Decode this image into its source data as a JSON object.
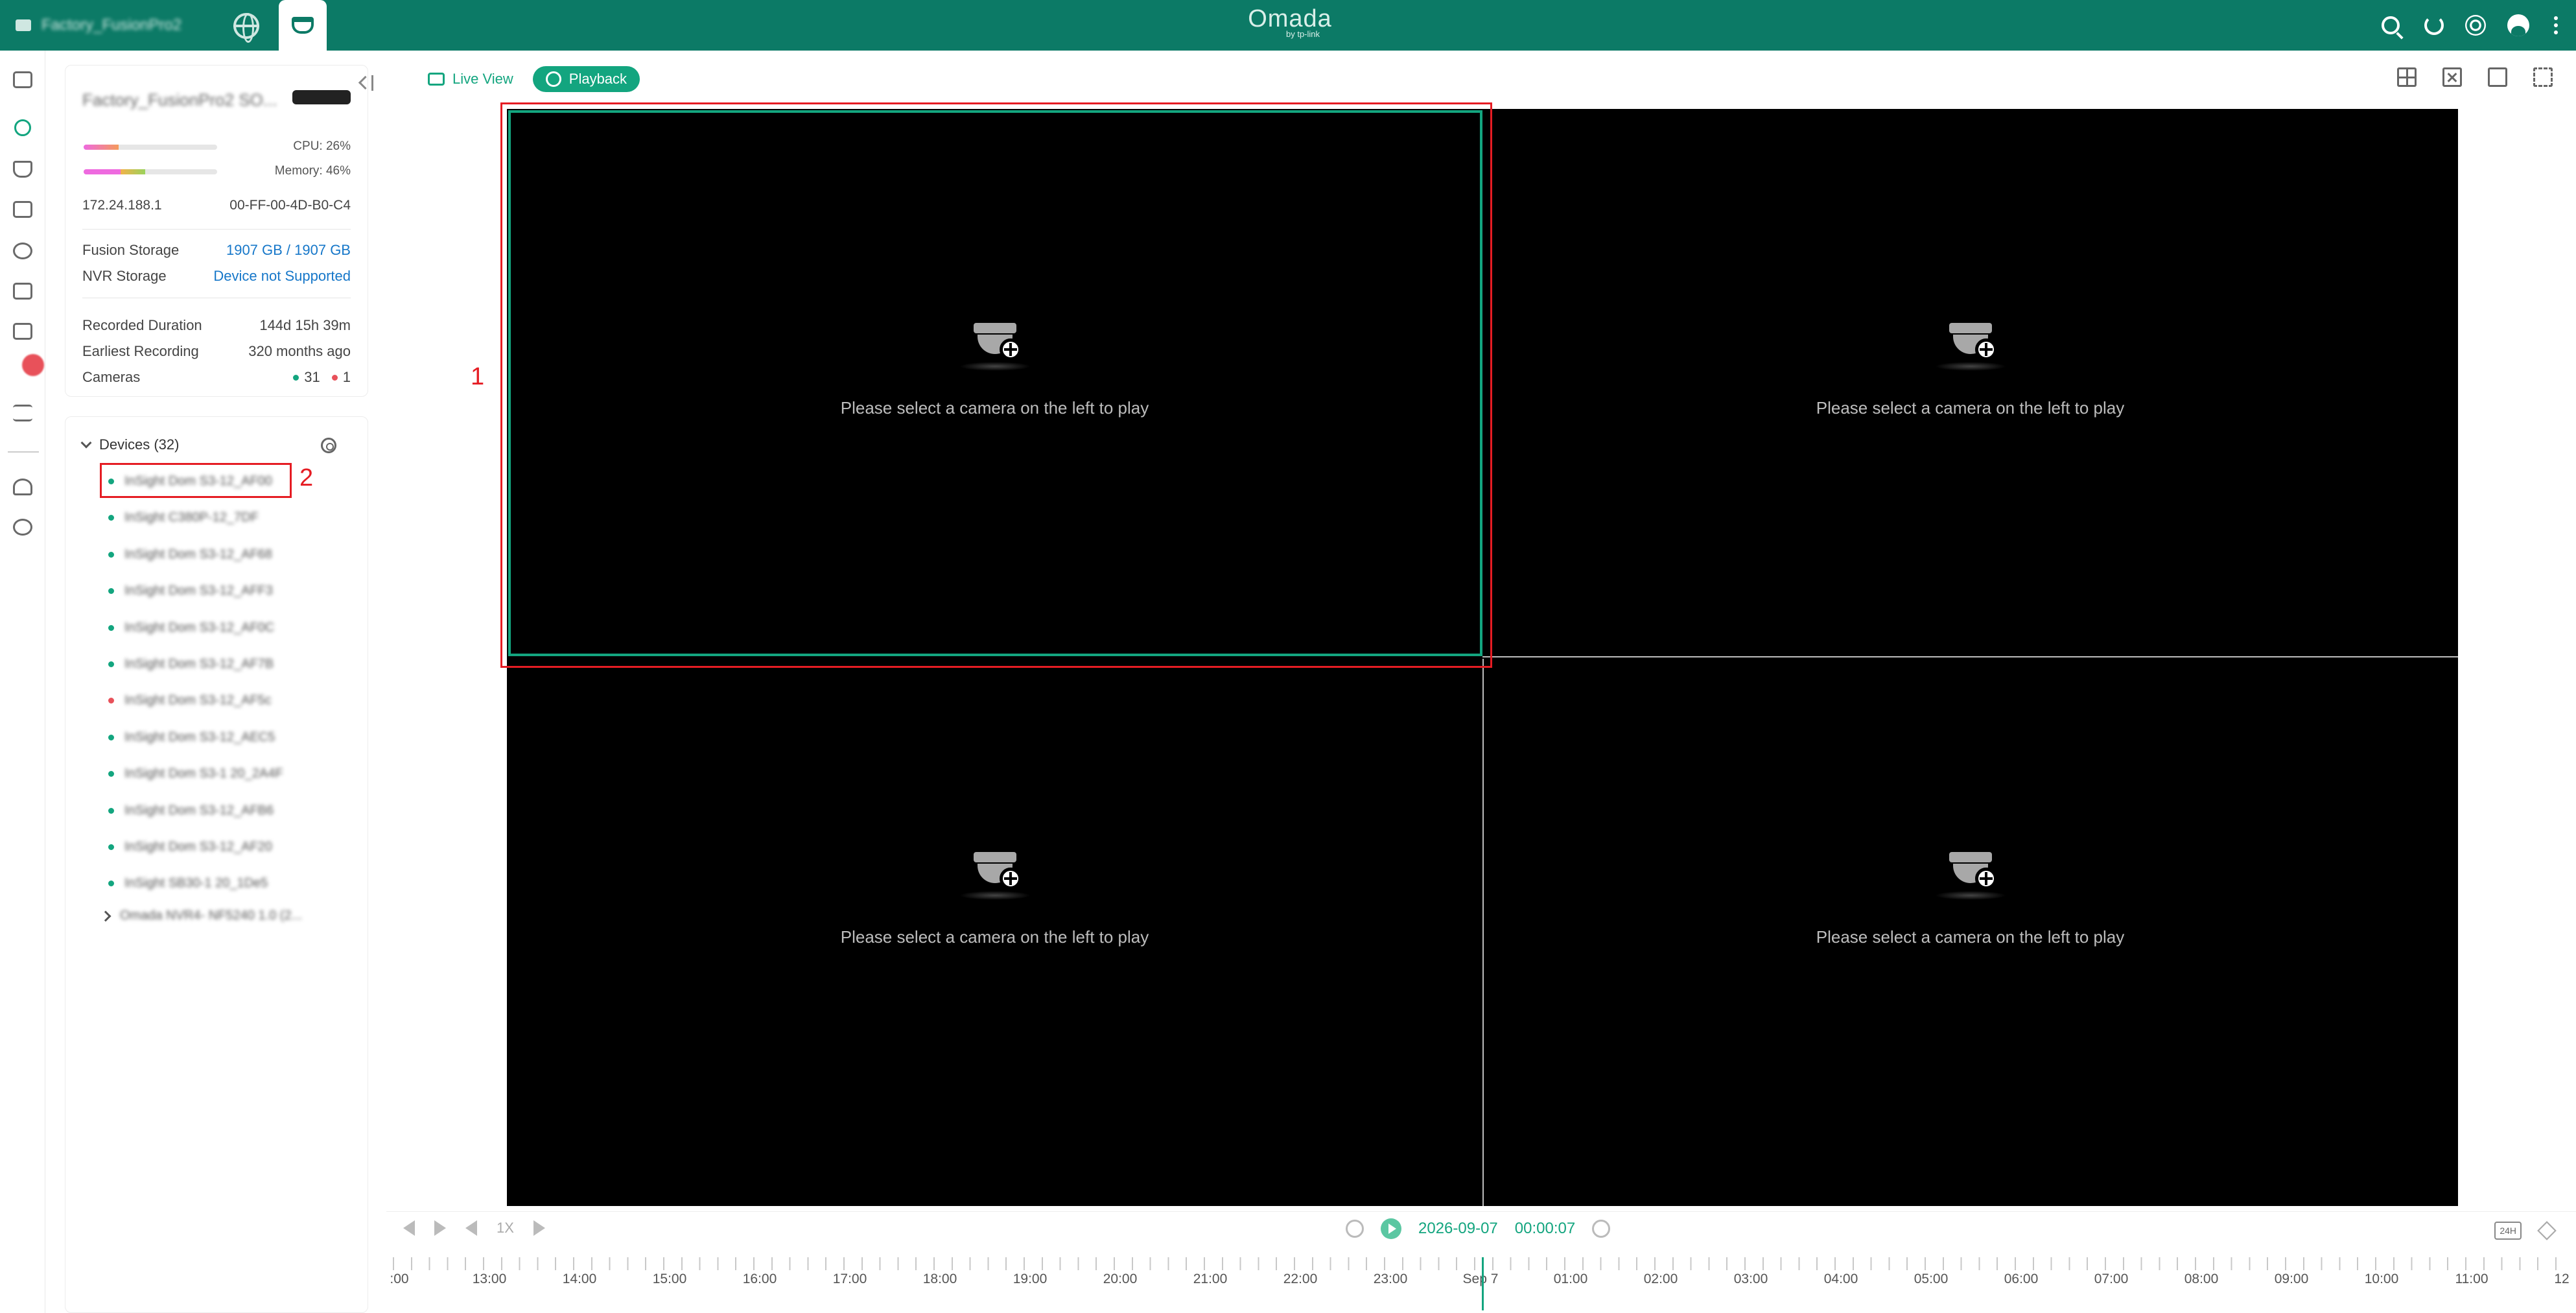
{
  "topbar": {
    "site_name": "Factory_FusionPro2",
    "logo": "Omada",
    "logo_sub": "by tp-link",
    "icons": [
      "search-icon",
      "refresh-icon",
      "theme-icon",
      "avatar",
      "more-icon"
    ]
  },
  "rail": {
    "icons": [
      "sidebar-toggle-icon",
      "playback-icon",
      "camera-icon",
      "nvr-icon",
      "analytics-icon",
      "folder-icon",
      "event-icon",
      "settings-sliders-icon",
      "user-icon",
      "gear-icon"
    ]
  },
  "info": {
    "device_name": "Factory_FusionPro2 SO...",
    "cpu": "CPU: 26%",
    "cpu_pct": 0.26,
    "memory": "Memory: 46%",
    "memory_pct": 0.46,
    "ip": "172.24.188.1",
    "mac": "00-FF-00-4D-B0-C4",
    "fusion_storage_label": "Fusion Storage",
    "fusion_storage_value": "1907 GB / 1907 GB",
    "nvr_storage_label": "NVR Storage",
    "nvr_storage_value": "Device not Supported",
    "recorded_duration_label": "Recorded Duration",
    "recorded_duration_value": "144d 15h 39m",
    "earliest_recording_label": "Earliest Recording",
    "earliest_recording_value": "320 months ago",
    "cameras_label": "Cameras",
    "cameras_online": "31",
    "cameras_offline": "1"
  },
  "devices": {
    "header": "Devices (32)",
    "items": [
      {
        "name": "InSight Dom S3-12_AF00",
        "status": "online"
      },
      {
        "name": "InSight C380P-12_7DF",
        "status": "online"
      },
      {
        "name": "InSight Dom S3-12_AF68",
        "status": "online"
      },
      {
        "name": "InSight Dom S3-12_AFF3",
        "status": "online"
      },
      {
        "name": "InSight Dom S3-12_AF0C",
        "status": "online"
      },
      {
        "name": "InSight Dom S3-12_AF7B",
        "status": "online"
      },
      {
        "name": "InSight Dom S3-12_AF5c",
        "status": "offline"
      },
      {
        "name": "InSight Dom S3-12_AEC5",
        "status": "online"
      },
      {
        "name": "InSight Dom S3-1 20_2A4F",
        "status": "online"
      },
      {
        "name": "InSight Dom S3-12_AFB6",
        "status": "online"
      },
      {
        "name": "InSight Dom S3-12_AF20",
        "status": "online"
      },
      {
        "name": "InSight SB30-1 20_1De5",
        "status": "online"
      }
    ],
    "group": "Omada NVR4- NF5240 1.0 (2..."
  },
  "main": {
    "live_view": "Live View",
    "playback": "Playback",
    "placeholder_msg": "Please select a camera on the left to play"
  },
  "annotations": {
    "one": "1",
    "two": "2"
  },
  "controls": {
    "speed": "1X",
    "date": "2026-09-07",
    "time": "00:00:07",
    "range": "24H",
    "ticks": [
      ":00",
      "13:00",
      "14:00",
      "15:00",
      "16:00",
      "17:00",
      "18:00",
      "19:00",
      "20:00",
      "21:00",
      "22:00",
      "23:00",
      "Sep 7",
      "01:00",
      "02:00",
      "03:00",
      "04:00",
      "05:00",
      "06:00",
      "07:00",
      "08:00",
      "09:00",
      "10:00",
      "11:00",
      "12"
    ]
  }
}
